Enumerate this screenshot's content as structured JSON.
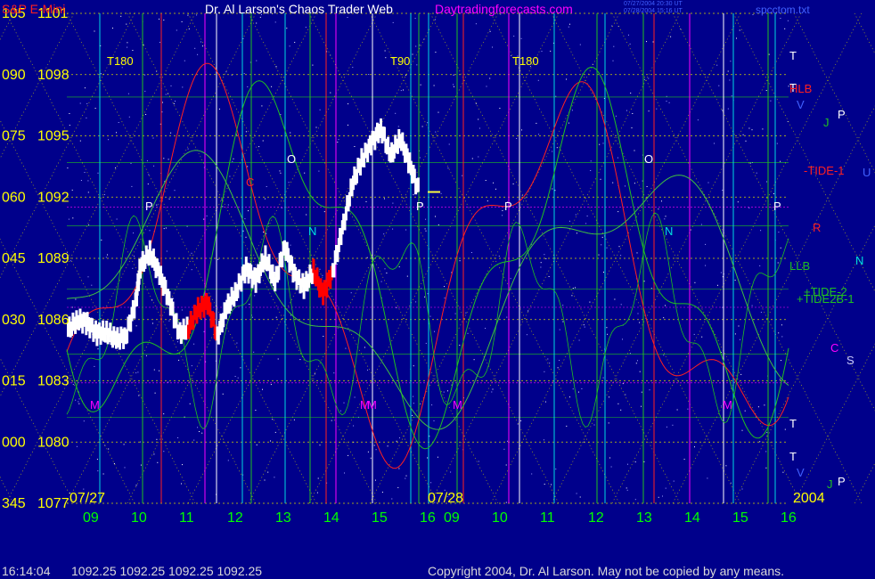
{
  "header": {
    "instrument": "S&P E-Mini",
    "title": "Dr. Al Larson's Chaos Trader Web",
    "site": "Daytradingforecasts.com",
    "stamp_lines": [
      "07/27/2004 20:30 UT",
      "07/28/2004 15:16 UT"
    ],
    "file": "spcctom.txt"
  },
  "footer": {
    "time": "16:14:04",
    "quote": "1092.25  1092.25  1092.25  1092.25",
    "copyright": "Copyright 2004, Dr. Al Larson. May not be copied by any means."
  },
  "colors": {
    "background": "#00008B",
    "axis_labels": "#ffff00",
    "hour_labels": "#00ff00",
    "price_bars": "#ffffff",
    "price_bars_down": "#ff0000",
    "red_field": "#ff2020",
    "green_field": "#20c020",
    "grid_yellow": "#d4d400",
    "grid_cyan": "#00d8e0",
    "grid_magenta": "#ff00ff"
  },
  "chart_data": {
    "type": "line",
    "title": "S&P E-Mini",
    "ylim": [
      1077,
      1101
    ],
    "y_ticks": [
      {
        "degree": "105",
        "price": "1101",
        "value": 1101
      },
      {
        "degree": "090",
        "price": "1098",
        "value": 1098
      },
      {
        "degree": "075",
        "price": "1095",
        "value": 1095
      },
      {
        "degree": "060",
        "price": "1092",
        "value": 1092
      },
      {
        "degree": "045",
        "price": "1089",
        "value": 1089
      },
      {
        "degree": "030",
        "price": "1086",
        "value": 1086
      },
      {
        "degree": "015",
        "price": "1083",
        "value": 1083
      },
      {
        "degree": "000",
        "price": "1080",
        "value": 1080
      },
      {
        "degree": "345",
        "price": "1077",
        "value": 1077
      }
    ],
    "xlim": [
      8.5,
      16.0
    ],
    "x_ticks": [
      "09",
      "10",
      "11",
      "12",
      "13",
      "14",
      "15",
      "16",
      "09",
      "10",
      "11",
      "12",
      "13",
      "14",
      "15",
      "16"
    ],
    "date_labels": [
      "07/27",
      "07/28",
      "2004"
    ],
    "price_series": {
      "name": "S&P E-Mini",
      "time": [
        8.5,
        8.7,
        8.9,
        9.1,
        9.3,
        9.5,
        9.7,
        9.9,
        10.0,
        10.2,
        10.4,
        10.6,
        10.8,
        11.0,
        11.2,
        11.4,
        11.6,
        11.8,
        12.0,
        12.2,
        12.4,
        12.6,
        12.8,
        13.0,
        13.2,
        13.4,
        13.6,
        13.8,
        14.0,
        14.2,
        14.4,
        14.6,
        14.8,
        15.0,
        15.2,
        15.4,
        15.6,
        15.8
      ],
      "price": [
        1085.5,
        1086,
        1085.8,
        1085.3,
        1085.4,
        1085,
        1085.2,
        1086.8,
        1088.6,
        1089.3,
        1088.2,
        1087,
        1085.3,
        1085.6,
        1086.5,
        1086.8,
        1085.2,
        1086.6,
        1087.4,
        1088.5,
        1087.9,
        1089.1,
        1087.8,
        1089.6,
        1088.2,
        1087.6,
        1088.4,
        1087.2,
        1088.4,
        1090.4,
        1092.6,
        1093.8,
        1094.6,
        1095.4,
        1094,
        1094.9,
        1093.6,
        1092.2
      ],
      "down_segments": [
        [
          11.0,
          1086.0
        ],
        [
          11.2,
          1085.6
        ],
        [
          11.4,
          1086.5
        ],
        [
          13.6,
          1087.3
        ],
        [
          13.8,
          1087.0
        ]
      ]
    },
    "last_price": 1092.25,
    "field_labels": [
      {
        "text": "T180",
        "color": "#ffff00"
      },
      {
        "text": "T90",
        "color": "#ffff00"
      },
      {
        "text": "T180",
        "color": "#ffff00"
      },
      {
        "text": "C",
        "color": "#ff2020"
      },
      {
        "text": "O",
        "color": "#ffffff"
      },
      {
        "text": "O",
        "color": "#ffffff"
      },
      {
        "text": "P",
        "color": "#ffffff"
      },
      {
        "text": "P",
        "color": "#ffffff"
      },
      {
        "text": "P",
        "color": "#ffffff"
      },
      {
        "text": "P",
        "color": "#ffffff"
      },
      {
        "text": "N",
        "color": "#00e0e0"
      },
      {
        "text": "N",
        "color": "#00e0e0"
      },
      {
        "text": "M",
        "color": "#ff00ff"
      },
      {
        "text": "M",
        "color": "#ff00ff"
      },
      {
        "text": "M",
        "color": "#ff00ff"
      },
      {
        "text": "M",
        "color": "#ff00ff"
      },
      {
        "text": "M",
        "color": "#ff00ff"
      },
      {
        "text": "T",
        "color": "#ffffff"
      },
      {
        "text": "T",
        "color": "#ffffff"
      },
      {
        "text": "T",
        "color": "#ffffff"
      },
      {
        "text": "T",
        "color": "#ffffff"
      },
      {
        "text": "V",
        "color": "#4060ff"
      },
      {
        "text": "V",
        "color": "#4060ff"
      },
      {
        "text": "P",
        "color": "#ffffff"
      },
      {
        "text": "P",
        "color": "#ffffff"
      },
      {
        "text": "J",
        "color": "#20c020"
      },
      {
        "text": "J",
        "color": "#20c020"
      },
      {
        "text": "HLB",
        "color": "#ff2020"
      },
      {
        "text": "-TIDE-1",
        "color": "#ff2020"
      },
      {
        "text": "U",
        "color": "#4060ff"
      },
      {
        "text": "R",
        "color": "#ff2020"
      },
      {
        "text": "LLB",
        "color": "#20c020"
      },
      {
        "text": "N",
        "color": "#00e0e0"
      },
      {
        "text": "+TIDE-2",
        "color": "#20c020"
      },
      {
        "text": "+TIDE2B-1",
        "color": "#20c020"
      },
      {
        "text": "C",
        "color": "#ff00ff"
      },
      {
        "text": "S",
        "color": "#c8c8ff"
      }
    ]
  }
}
